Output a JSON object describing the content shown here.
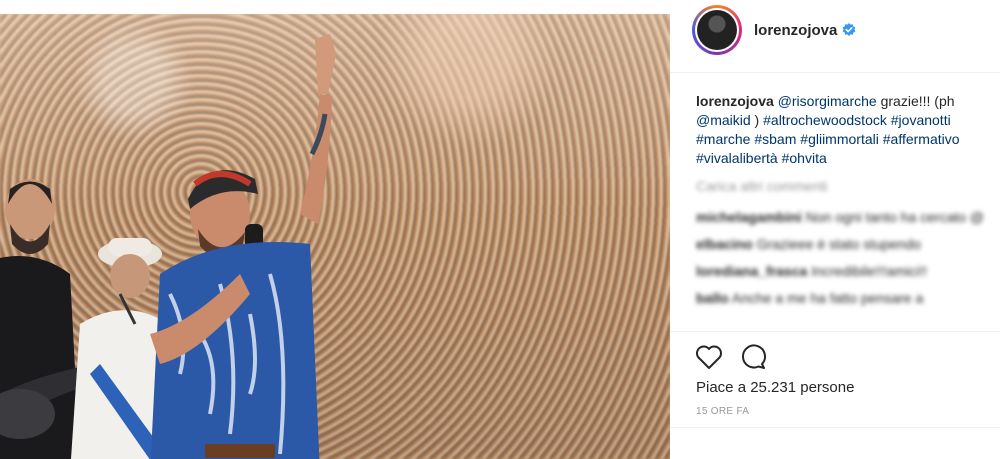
{
  "header": {
    "username": "lorenzojova"
  },
  "caption": {
    "user": "lorenzojova",
    "mention": "@risorgimarche",
    "text1": " grazie!!! (ph ",
    "mention2": "@maikid",
    "text2": " ) ",
    "tags": [
      "#altrochewoodstock",
      "#jovanotti",
      "#marche",
      "#sbam",
      "#gliimmortali",
      "#affermativo",
      "#vivalalibertà",
      "#ohvita"
    ]
  },
  "load_more": "Carica altri commenti",
  "comments": [
    {
      "user": "michelagambini",
      "text": "Non ogni tanto ha cercato @"
    },
    {
      "user": "elbacino",
      "text": "Grazieee è stato stupendo"
    },
    {
      "user": "lorediana_frasca",
      "text": "Incredibile!!!amici!!"
    },
    {
      "user": "ballo",
      "text": "Anche a me ha fatto pensare a"
    }
  ],
  "icons": {
    "like": "heart-icon",
    "comment": "comment-icon",
    "verified": "verified-badge-icon"
  },
  "colors": {
    "link": "#003569",
    "verified": "#3897f0",
    "muted": "#999999"
  },
  "likes": "Piace a 25.231 persone",
  "time": "15 ORE FA"
}
